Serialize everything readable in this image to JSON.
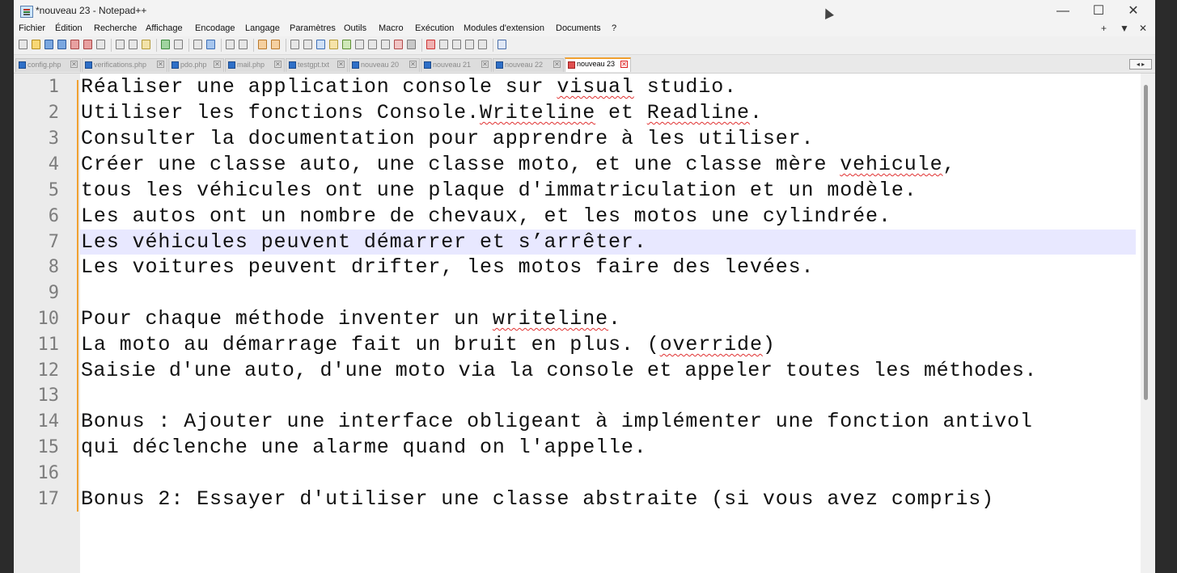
{
  "window": {
    "title": "*nouveau 23 - Notepad++",
    "controls": {
      "minimize": "—",
      "maximize": "☐",
      "close": "✕"
    }
  },
  "menu": {
    "items": [
      "Fichier",
      "Édition",
      "Recherche",
      "Affichage",
      "Encodage",
      "Langage",
      "Paramètres",
      "Outils",
      "Macro",
      "Exécution",
      "Modules d'extension",
      "Documents",
      "?"
    ],
    "right": [
      "+",
      "▼",
      "✕"
    ]
  },
  "tabs": [
    {
      "label": "config.php",
      "close": "✕",
      "active": false
    },
    {
      "label": "verifications.php",
      "close": "✕",
      "active": false
    },
    {
      "label": "pdo.php",
      "close": "✕",
      "active": false
    },
    {
      "label": "mail.php",
      "close": "✕",
      "active": false
    },
    {
      "label": "testgpt.txt",
      "close": "✕",
      "active": false
    },
    {
      "label": "nouveau 20",
      "close": "✕",
      "active": false
    },
    {
      "label": "nouveau 21",
      "close": "✕",
      "active": false
    },
    {
      "label": "nouveau 22",
      "close": "✕",
      "active": false
    },
    {
      "label": "nouveau 23",
      "close": "✕",
      "active": true
    }
  ],
  "tab_scroll": "◂ ▸",
  "editor": {
    "current_line": 7,
    "lines": [
      {
        "n": "1",
        "text": "Réaliser une application console sur visual studio."
      },
      {
        "n": "2",
        "text": "Utiliser les fonctions Console.Writeline et Readline."
      },
      {
        "n": "3",
        "text": "Consulter la documentation pour apprendre à les utiliser."
      },
      {
        "n": "4",
        "text": "Créer une classe auto, une classe moto, et une classe mère vehicule,"
      },
      {
        "n": "5",
        "text": "tous les véhicules ont une plaque d'immatriculation et un modèle."
      },
      {
        "n": "6",
        "text": "Les autos ont un nombre de chevaux, et les motos une cylindrée."
      },
      {
        "n": "7",
        "text": "Les véhicules peuvent démarrer et s’arrêter."
      },
      {
        "n": "8",
        "text": "Les voitures peuvent drifter, les motos faire des levées."
      },
      {
        "n": "9",
        "text": ""
      },
      {
        "n": "10",
        "text": "Pour chaque méthode inventer un writeline."
      },
      {
        "n": "11",
        "text": "La moto au démarrage fait un bruit en plus. (override)"
      },
      {
        "n": "12",
        "text": "Saisie d'une auto, d'une moto via la console et appeler toutes les méthodes."
      },
      {
        "n": "13",
        "text": ""
      },
      {
        "n": "14",
        "text": "Bonus : Ajouter une interface obligeant à implémenter une fonction antivol"
      },
      {
        "n": "15",
        "text": "qui déclenche une alarme quand on l'appelle."
      },
      {
        "n": "16",
        "text": ""
      },
      {
        "n": "17",
        "text": "Bonus 2: Essayer d'utiliser une classe abstraite (si vous avez compris)"
      }
    ]
  },
  "colors": {
    "current_line": "#e8e8ff",
    "fold_margin": "#f0a030",
    "spell_underline": "#e03030"
  }
}
